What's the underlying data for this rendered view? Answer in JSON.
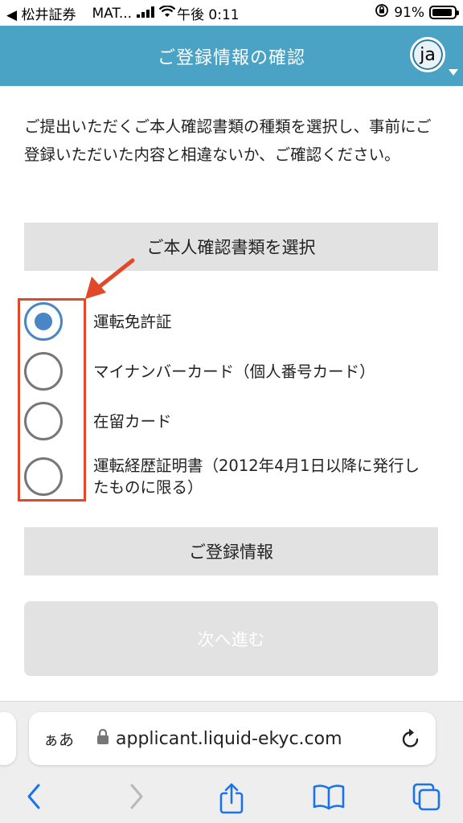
{
  "status_bar": {
    "back_app": "◀ 松井証券",
    "carrier": "MAT...",
    "time": "午後 0:11",
    "battery": "91%",
    "battery_level": 0.91
  },
  "header": {
    "title": "ご登録情報の確認",
    "lang": "ja"
  },
  "intro": "ご提出いただくご本人確認書類の種類を選択し、事前にご登録いただいた内容と相違ないか、ご確認ください。",
  "doc_section": {
    "title": "ご本人確認書類を選択",
    "options": [
      {
        "label": "運転免許証",
        "selected": true
      },
      {
        "label": "マイナンバーカード（個人番号カード）",
        "selected": false
      },
      {
        "label": "在留カード",
        "selected": false
      },
      {
        "label": "運転経歴証明書（2012年4月1日以降に発行したものに限る）",
        "selected": false
      }
    ]
  },
  "registration_section": {
    "title": "ご登録情報"
  },
  "next_button": "次へ進む",
  "browser": {
    "aa": "ぁあ",
    "url": "applicant.liquid-ekyc.com"
  },
  "colors": {
    "header": "#4aa2c4",
    "radio_selected": "#4a86c6",
    "annotation": "#e04a2a",
    "ios_blue": "#1a73e8"
  }
}
